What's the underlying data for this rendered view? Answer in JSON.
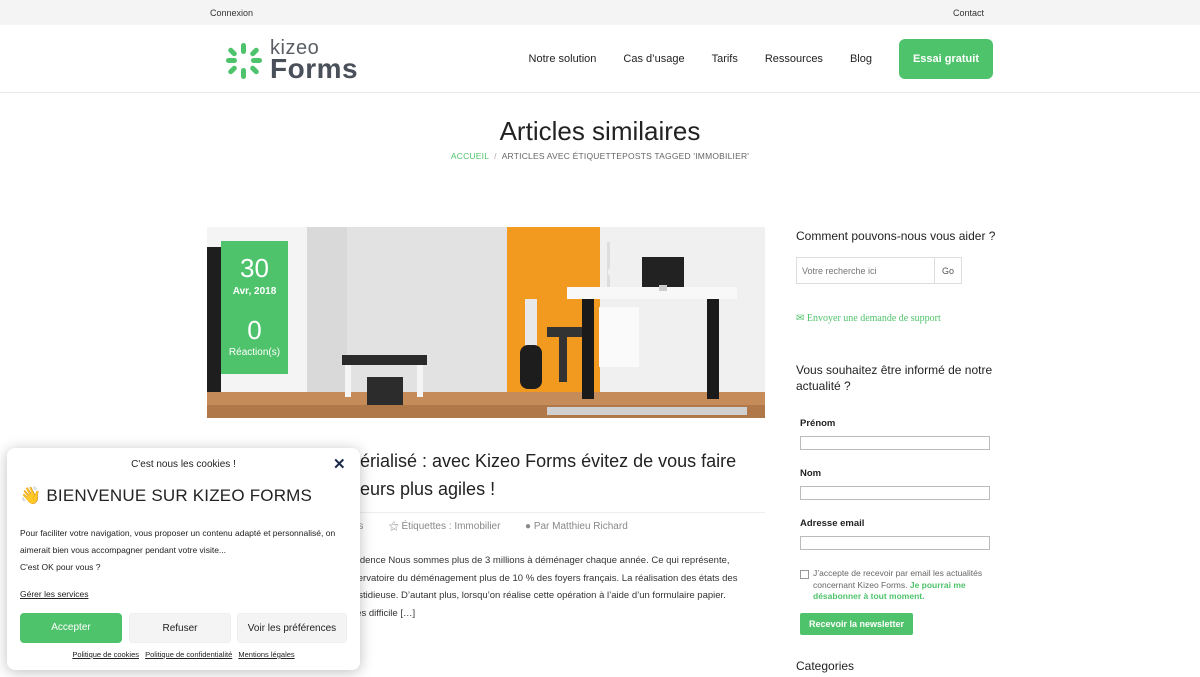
{
  "topbar": {
    "login": "Connexion",
    "contact": "Contact"
  },
  "logo": {
    "top": "kizeo",
    "bottom": "Forms"
  },
  "nav": {
    "items": [
      "Notre solution",
      "Cas d’usage",
      "Tarifs",
      "Ressources",
      "Blog"
    ],
    "cta": "Essai gratuit"
  },
  "page": {
    "title": "Articles similaires",
    "breadcrumb_home": "ACCUEIL",
    "breadcrumb_sep": "/",
    "breadcrumb_current": "ARTICLES AVEC ÉTIQUETTEPOSTS TAGGED 'IMMOBILIER'"
  },
  "post": {
    "day": "30",
    "month": "Avr, 2018",
    "reactions_count": "0",
    "reactions_label": "Réaction(s)",
    "title_line1": "térialisé : avec Kizeo Forms évitez de vous faire",
    "title_line2": "teurs plus agiles !",
    "meta_category": "rs",
    "meta_tags": "Étiquettes : Immobilier",
    "meta_author": "Par Matthieu Richard",
    "excerpt_lines": [
      "vidence Nous sommes plus de 3 millions à déménager chaque année. Ce qui représente,",
      "servatoire du déménagement plus de 10 % des foyers français. La réalisation des états des",
      "astidieuse. D’autant plus, lorsqu’on réalise cette opération à l’aide d’un formulaire papier.",
      "rès difficile […]"
    ]
  },
  "sidebar": {
    "help_title": "Comment pouvons-nous vous aider ?",
    "search_placeholder": "Votre recherche ici",
    "search_button": "Go",
    "support_link": "Envoyer une demande de support",
    "newsletter_title": "Vous souhaitez être informé de notre actualité ?",
    "label_firstname": "Prénom",
    "label_name": "Nom",
    "label_email": "Adresse email",
    "consent_text": "J’accepte de recevoir par email les actualités concernant Kizeo Forms.",
    "consent_em": "Je pourrai me désabonner à tout moment.",
    "newsletter_button": "Recevoir la newsletter",
    "categories_title": "Categories"
  },
  "cookie": {
    "header": "C'est nous les cookies !",
    "close": "✕",
    "wave": "👋",
    "title": "BIENVENUE SUR KIZEO FORMS",
    "body_line1": "Pour faciliter votre navigation, vous proposer un contenu adapté et personnalisé, on",
    "body_line2": "aimerait bien vous accompagner pendant votre visite...",
    "body_line3": "C'est OK pour vous ?",
    "manage": "Gérer les services",
    "accept": "Accepter",
    "refuse": "Refuser",
    "prefs": "Voir les préférences",
    "link_cookies": "Politique de cookies",
    "link_privacy": "Politique de confidentialité",
    "link_legal": "Mentions légales"
  },
  "colors": {
    "accent": "#4fc36b",
    "text": "#222222",
    "topbar_bg": "#f4f4f4"
  }
}
